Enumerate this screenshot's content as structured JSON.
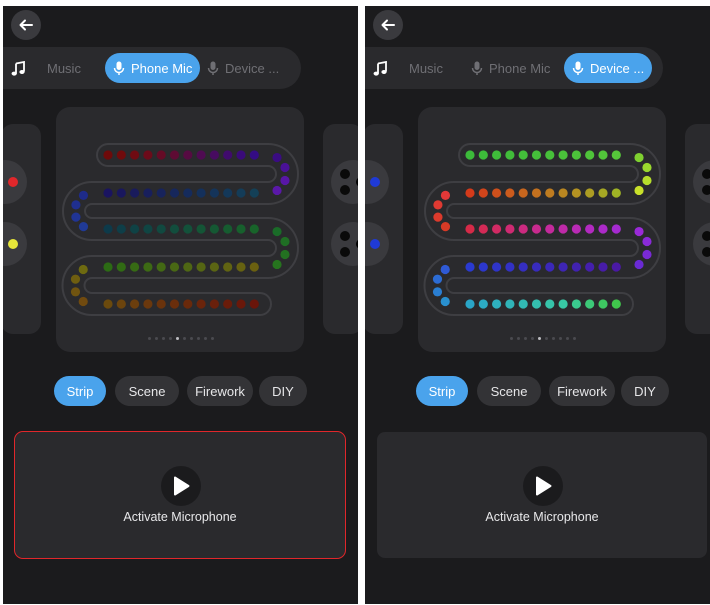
{
  "sources": [
    {
      "label": "Music",
      "icon": "music-note-icon"
    },
    {
      "label": "Phone Mic",
      "icon": "microphone-icon"
    },
    {
      "label": "Device ...",
      "icon": "microphone-icon"
    }
  ],
  "tabs": [
    "Strip",
    "Scene",
    "Firework",
    "DIY"
  ],
  "activate_label": "Activate Microphone",
  "colors": {
    "accent": "#4aa3ec",
    "highlight_outline": "#e0272b"
  },
  "panels": [
    {
      "id": "left",
      "active_source": 1,
      "active_tab": 0,
      "outlined_mic_card": true,
      "page_indicator": {
        "count": 10,
        "active": 4
      },
      "strip_rows": [
        [
          "#6e0a0a",
          "#700b0c",
          "#6f0b12",
          "#6c0b1a",
          "#650b26",
          "#5e0b33",
          "#560b42",
          "#4f0b52",
          "#470b60",
          "#400b6d",
          "#3a0b7a",
          "#340c84"
        ],
        [
          "#1a1460",
          "#19175e",
          "#191b5c",
          "#181f5c",
          "#17235c",
          "#16275c",
          "#152b5c",
          "#14305b",
          "#14345a",
          "#143859",
          "#143c58",
          "#144057"
        ],
        [
          "#0d3a4a",
          "#0e3e48",
          "#0f4245",
          "#104543",
          "#114940",
          "#124d3d",
          "#13513a",
          "#145536",
          "#155833",
          "#165c30",
          "#17602d",
          "#18642a"
        ],
        [
          "#2c6b14",
          "#316b14",
          "#376b14",
          "#3d6a14",
          "#436914",
          "#496814",
          "#4f6714",
          "#556613",
          "#5b6513",
          "#616412",
          "#666211",
          "#6b6010"
        ],
        [
          "#6b4a0d",
          "#6b440d",
          "#6b3e0d",
          "#6b380d",
          "#6a330c",
          "#6a2e0c",
          "#6a290b",
          "#6a240b",
          "#6a200b",
          "#6a1c0a",
          "#6a180a",
          "#6a150a"
        ]
      ],
      "turn_dots": {
        "right1": [
          "#3a0c82",
          "#4a1196",
          "#5816a6",
          "#5a18a8"
        ],
        "left1": [
          "#1e2b8a",
          "#1f2f90",
          "#203494",
          "#203a96"
        ],
        "right2": [
          "#1a6b28",
          "#1f6e24",
          "#237121",
          "#26741e"
        ],
        "left2": [
          "#6e6a10",
          "#6f5e10",
          "#705410",
          "#704a0f"
        ]
      },
      "side_left_dots": [
        "#e0272b",
        "#e6e63a"
      ],
      "side_right_dots": [
        "#000000",
        "#000000"
      ]
    },
    {
      "id": "right",
      "active_source": 2,
      "active_tab": 0,
      "outlined_mic_card": false,
      "page_indicator": {
        "count": 10,
        "active": 4
      },
      "strip_rows": [
        [
          "#3cba3a",
          "#3dbb3a",
          "#3fbc3a",
          "#41bd3a",
          "#43be3a",
          "#45bf3a",
          "#47c03a",
          "#4ac13a",
          "#4cc23a",
          "#4fc33a",
          "#52c43a",
          "#56c53a"
        ],
        [
          "#d43a1a",
          "#d2451b",
          "#cf501c",
          "#cc5b1d",
          "#c8661e",
          "#c4711f",
          "#bf7c20",
          "#ba8721",
          "#b49222",
          "#ad9d23",
          "#a6a824",
          "#9fb325"
        ],
        [
          "#d62a48",
          "#d42a56",
          "#d22a64",
          "#cf2a72",
          "#cc2a80",
          "#c82a8e",
          "#c42a9c",
          "#bf2aa9",
          "#b92ab5",
          "#b32ac0",
          "#ac2ac9",
          "#a52ad0"
        ],
        [
          "#2a3ad0",
          "#2c37cc",
          "#2f34c8",
          "#3231c4",
          "#352ec0",
          "#382bbc",
          "#3b28b8",
          "#3e25b4",
          "#4122b0",
          "#441fac",
          "#471ca8",
          "#4a19a4"
        ],
        [
          "#2aa6c8",
          "#2cabc3",
          "#2eb0be",
          "#30b5b9",
          "#32bab4",
          "#34bfaf",
          "#36c4aa",
          "#38c9a5",
          "#3aca8e",
          "#3cc978",
          "#3ec862",
          "#40c74c"
        ]
      ],
      "turn_dots": {
        "right1": [
          "#7fd030",
          "#9ad82e",
          "#b6de2c",
          "#c8e02a"
        ],
        "left1": [
          "#e23838",
          "#e03a32",
          "#dc3a2c",
          "#d83a26"
        ],
        "right2": [
          "#9a2ad8",
          "#8a2ad8",
          "#7a2ad6",
          "#6a2ad4"
        ],
        "left2": [
          "#2f5ad6",
          "#2c6cd4",
          "#2a7ed2",
          "#2990cf"
        ]
      },
      "side_left_dots": [
        "#1f3ad6",
        "#1f3ad6"
      ],
      "side_right_dots": [
        "#e0272b",
        "#1f3ad6"
      ]
    }
  ]
}
